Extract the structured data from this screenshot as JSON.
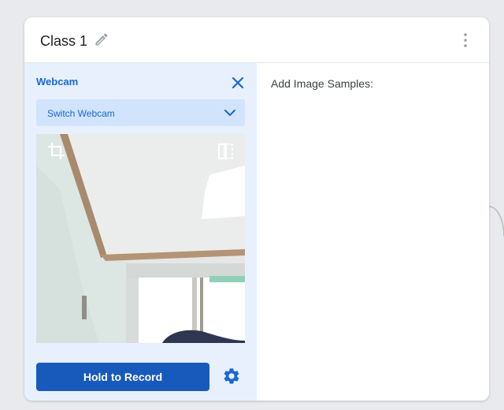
{
  "class_card": {
    "title": "Class 1",
    "icons": {
      "edit": "pencil-icon",
      "more": "more-vert-icon"
    }
  },
  "webcam_panel": {
    "label": "Webcam",
    "close_icon": "close-icon",
    "switch_select": {
      "selected": "Switch Webcam",
      "icon": "chevron-down-icon"
    },
    "feed_icons": {
      "crop": "crop-icon",
      "flip": "flip-horizontal-icon"
    },
    "record_button_label": "Hold to Record",
    "settings_icon": "gear-icon"
  },
  "samples_panel": {
    "label": "Add Image Samples:"
  },
  "colors": {
    "accent": "#1967d2",
    "button": "#185abc",
    "panel_bg": "#e8f0fe",
    "select_bg": "#d2e3fc",
    "page_bg": "#e8eaed"
  }
}
